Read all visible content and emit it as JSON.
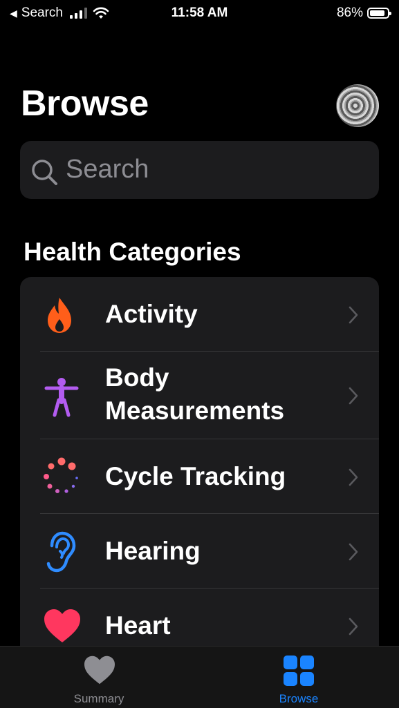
{
  "status_bar": {
    "back_app": "Search",
    "time": "11:58 AM",
    "battery": "86%",
    "battery_level": 0.86
  },
  "page": {
    "title": "Browse"
  },
  "search": {
    "placeholder": "Search"
  },
  "section": {
    "title": "Health Categories"
  },
  "categories": [
    {
      "line1": "Activity",
      "line2": "",
      "icon": "flame-icon",
      "color": "#ff5e1a"
    },
    {
      "line1": "Body",
      "line2": "Measurements",
      "icon": "body-figure-icon",
      "color": "#b35cf0"
    },
    {
      "line1": "Cycle Tracking",
      "line2": "",
      "icon": "cycle-dots-icon",
      "color": "#ff6b6b"
    },
    {
      "line1": "Hearing",
      "line2": "",
      "icon": "ear-icon",
      "color": "#2f8cff"
    },
    {
      "line1": "Heart",
      "line2": "",
      "icon": "heart-icon",
      "color": "#ff375f"
    }
  ],
  "tabbar": {
    "summary_label": "Summary",
    "browse_label": "Browse",
    "active_color": "#1a84ff",
    "inactive_color": "#8e8e93"
  }
}
